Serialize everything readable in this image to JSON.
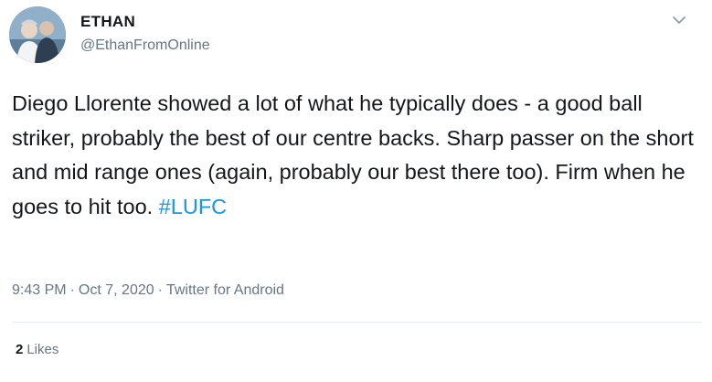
{
  "author": {
    "name": "ETHAN",
    "handle": "@EthanFromOnline"
  },
  "tweet": {
    "text": "Diego Llorente showed a lot of what he typically does - a good ball striker, probably the best of our centre backs. Sharp passer on the short and mid range ones (again, probably our best there too). Firm when he goes to hit too.",
    "hashtag": "#LUFC",
    "time": "9:43 PM",
    "date": "Oct 7, 2020",
    "separator": "·",
    "source": "Twitter for Android"
  },
  "engagement": {
    "likes_count": "2",
    "likes_label": "Likes"
  },
  "icons": {
    "menu": "chevron-down-icon"
  },
  "colors": {
    "link": "#1b95e0",
    "secondary_text": "#657786",
    "primary_text": "#14171a"
  }
}
